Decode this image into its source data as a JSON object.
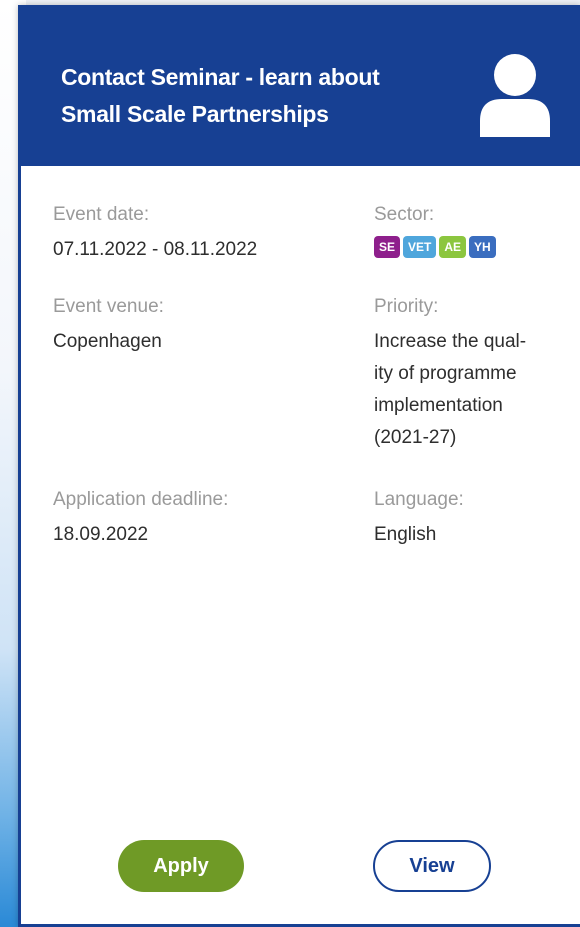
{
  "card": {
    "title": "Contact Seminar - learn about Small Scale Partnerships",
    "icon": "user-avatar-icon",
    "header_color": "#174093"
  },
  "fields": {
    "event_date": {
      "label": "Event date:",
      "value": "07.11.2022 - 08.11.2022"
    },
    "sector": {
      "label": "Sector:",
      "badges": [
        {
          "text": "SE",
          "color": "#8e1f8c"
        },
        {
          "text": "VET",
          "color": "#4fa6dc"
        },
        {
          "text": "AE",
          "color": "#8cc63f"
        },
        {
          "text": "YH",
          "color": "#3a6dbf"
        }
      ]
    },
    "event_venue": {
      "label": "Event venue:",
      "value": "Copenhagen"
    },
    "priority": {
      "label": "Priority:",
      "lines": [
        "Increase the qual-",
        "ity of programme",
        "implementation",
        "(2021-27)"
      ]
    },
    "application_deadline": {
      "label": "Application deadline:",
      "value": "18.09.2022"
    },
    "language": {
      "label": "Language:",
      "value": "English"
    }
  },
  "actions": {
    "apply_label": "Apply",
    "apply_color": "#6f9a26",
    "view_label": "View"
  }
}
